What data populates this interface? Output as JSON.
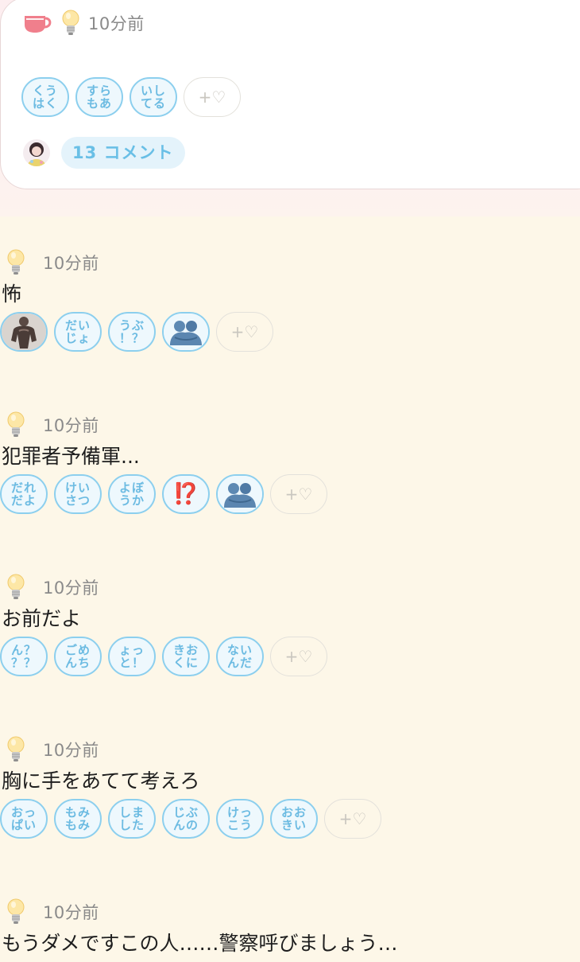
{
  "featured": {
    "time": "10分前",
    "reactions": [
      "くう\nはく",
      "すら\nもあ",
      "いし\nてる"
    ],
    "add_reaction": "+♡",
    "comment_label": "13 コメント"
  },
  "posts": [
    {
      "time": "10分前",
      "text": "怖",
      "reactions": [
        {
          "type": "image",
          "icon": "muscle-man-icon"
        },
        {
          "type": "text",
          "label": "だい\nじょ"
        },
        {
          "type": "text",
          "label": "うぶ\n！？"
        },
        {
          "type": "image",
          "icon": "hug-statue-icon"
        }
      ],
      "add_reaction": "+♡"
    },
    {
      "time": "10分前",
      "text": "犯罪者予備軍...",
      "reactions": [
        {
          "type": "text",
          "label": "だれ\nだよ"
        },
        {
          "type": "text",
          "label": "けい\nさつ"
        },
        {
          "type": "text",
          "label": "よぼ\nうか"
        },
        {
          "type": "emoji",
          "label": "⁉️"
        },
        {
          "type": "image",
          "icon": "hug-statue-icon"
        }
      ],
      "add_reaction": "+♡"
    },
    {
      "time": "10分前",
      "text": "お前だよ",
      "reactions": [
        {
          "type": "text",
          "label": "ん？\n？？"
        },
        {
          "type": "text",
          "label": "ごめ\nんち"
        },
        {
          "type": "text",
          "label": "ょっ\nと！"
        },
        {
          "type": "text",
          "label": "きお\nくに"
        },
        {
          "type": "text",
          "label": "ない\nんだ"
        }
      ],
      "add_reaction": "+♡"
    },
    {
      "time": "10分前",
      "text": "胸に手をあてて考えろ",
      "reactions": [
        {
          "type": "text",
          "label": "おっ\nぱい"
        },
        {
          "type": "text",
          "label": "もみ\nもみ"
        },
        {
          "type": "text",
          "label": "しま\nした"
        },
        {
          "type": "text",
          "label": "じぶ\nんの"
        },
        {
          "type": "text",
          "label": "けっ\nこう"
        },
        {
          "type": "text",
          "label": "おお\nきい"
        }
      ],
      "add_reaction": "+♡"
    },
    {
      "time": "10分前",
      "text": "もうダメですこの人……警察呼びましょう…",
      "reactions": [],
      "add_reaction": ""
    }
  ],
  "colors": {
    "reaction_border": "#8ccfee",
    "reaction_text": "#6cbbe2",
    "comment_pill_bg": "#e4f3fb",
    "page_bg": "#fdf7e8"
  }
}
